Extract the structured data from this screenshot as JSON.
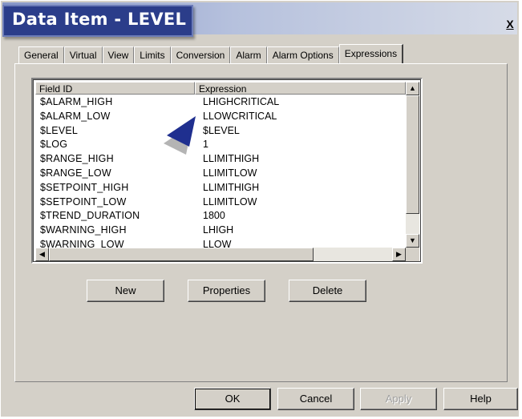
{
  "window": {
    "title": "Data Item - LEVEL",
    "close_label": "X"
  },
  "tabs": [
    {
      "label": "General",
      "active": false
    },
    {
      "label": "Virtual",
      "active": false
    },
    {
      "label": "View",
      "active": false
    },
    {
      "label": "Limits",
      "active": false
    },
    {
      "label": "Conversion",
      "active": false
    },
    {
      "label": "Alarm",
      "active": false
    },
    {
      "label": "Alarm Options",
      "active": false
    },
    {
      "label": "Expressions",
      "active": true
    }
  ],
  "table": {
    "headers": [
      "Field ID",
      "Expression"
    ],
    "rows": [
      [
        "$ALARM_HIGH",
        "LHIGHCRITICAL"
      ],
      [
        "$ALARM_LOW",
        "LLOWCRITICAL"
      ],
      [
        "$LEVEL",
        "$LEVEL"
      ],
      [
        "$LOG",
        "1"
      ],
      [
        "$RANGE_HIGH",
        "LLIMITHIGH"
      ],
      [
        "$RANGE_LOW",
        "LLIMITLOW"
      ],
      [
        "$SETPOINT_HIGH",
        "LLIMITHIGH"
      ],
      [
        "$SETPOINT_LOW",
        "LLIMITLOW"
      ],
      [
        "$TREND_DURATION",
        "1800"
      ],
      [
        "$WARNING_HIGH",
        "LHIGH"
      ],
      [
        "$WARNING_LOW",
        "LLOW"
      ]
    ]
  },
  "panel_buttons": {
    "new": "New",
    "properties": "Properties",
    "delete": "Delete"
  },
  "footer_buttons": {
    "ok": "OK",
    "cancel": "Cancel",
    "apply": "Apply",
    "help": "Help"
  },
  "colors": {
    "title_pill": "#2b3d8a",
    "cursor": "#1f2f8f",
    "dialog_face": "#d4d0c8"
  }
}
